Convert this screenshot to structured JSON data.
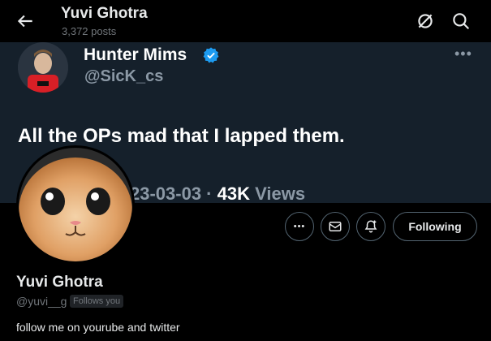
{
  "header": {
    "title": "Yuvi Ghotra",
    "subtitle": "3,372 posts",
    "icons": [
      "back-arrow-icon",
      "unfollow-notify-icon",
      "search-icon"
    ]
  },
  "banner": {
    "author_name": "Hunter Mims",
    "author_handle": "@SicK_cs",
    "more": "•••",
    "post_text": "All the OPs mad that I lapped them.",
    "date_visible": "23-03-03 · ",
    "views_count": "43K",
    "views_label": " Views"
  },
  "actions": {
    "more_label": "•••",
    "follow_label": "Following"
  },
  "profile": {
    "name": "Yuvi Ghotra",
    "handle": "@yuvi__g",
    "follows_badge": "Follows you",
    "bio": "follow me on yourube and twitter"
  },
  "colors": {
    "background": "#000000",
    "banner": "#15202b",
    "verified": "#1d9bf0",
    "muted": "#71767b"
  }
}
